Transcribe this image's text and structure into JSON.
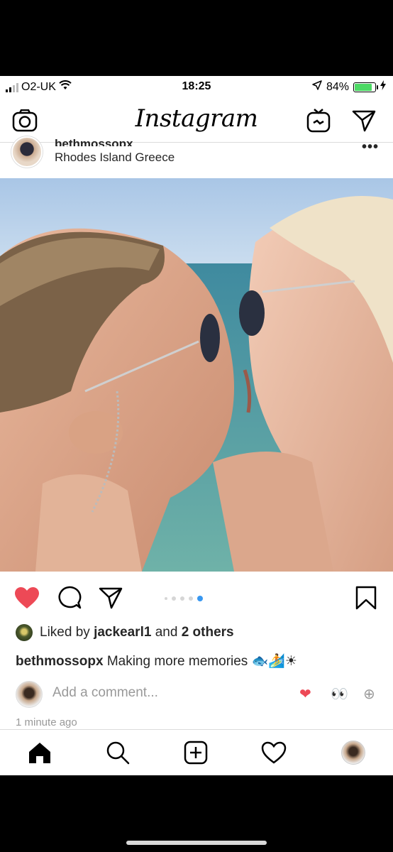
{
  "status_bar": {
    "carrier": "O2-UK",
    "time": "18:25",
    "battery_percent": "84%",
    "battery_level": 0.84,
    "icons": [
      "signal-icon",
      "wifi-icon",
      "location-arrow-icon",
      "battery-icon",
      "charging-icon"
    ]
  },
  "nav": {
    "brand": "Instagram",
    "icons": [
      "camera-icon",
      "igtv-icon",
      "direct-send-icon"
    ]
  },
  "post": {
    "username": "bethmossopx",
    "location": "Rhodes Island Greece",
    "more": "•••",
    "carousel_total": 5,
    "carousel_active": 5,
    "liked": true
  },
  "likes": {
    "prefix": "Liked by",
    "user": "jackearl1",
    "joiner": "and",
    "others": "2 others"
  },
  "caption": {
    "username": "bethmossopx",
    "text": "Making more memories",
    "emojis": "🐟🏄☀"
  },
  "comment": {
    "placeholder": "Add a comment...",
    "quick_reactions": [
      "❤",
      "👀",
      "⊕"
    ]
  },
  "timestamp": "1 minute ago",
  "tab_bar": {
    "tabs": [
      "home-icon",
      "search-icon",
      "add-icon",
      "heart-icon",
      "profile-icon"
    ]
  },
  "colors": {
    "like_red": "#ed4956",
    "accent_blue": "#3897f0",
    "border": "#dbdbdb",
    "muted": "#999999"
  }
}
